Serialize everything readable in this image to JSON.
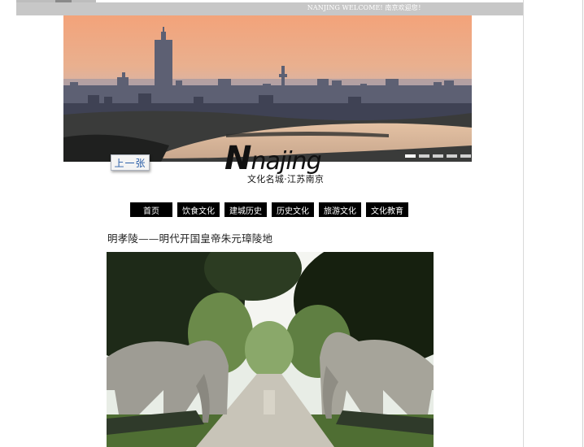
{
  "header": {
    "welcome_text": "NANJING WELCOME! 南京欢迎您！"
  },
  "banner": {
    "alt": "南京城市天际线",
    "slide_count": 5,
    "active_slide": 1
  },
  "prev_button": {
    "label": "上一张"
  },
  "logo": {
    "cap": "N",
    "word": "najing",
    "subtitle": "文化名城·江苏南京"
  },
  "nav": {
    "items": [
      {
        "label": "首页"
      },
      {
        "label": "饮食文化"
      },
      {
        "label": "建城历史"
      },
      {
        "label": "历史文化"
      },
      {
        "label": "旅游文化"
      },
      {
        "label": "文化教育"
      }
    ]
  },
  "article": {
    "title": "明孝陵——明代开国皇帝朱元璋陵地"
  },
  "colors": {
    "nav_bg": "#000000",
    "nav_text": "#ffffff",
    "welcome_bar": "#c7c7c7",
    "prev_text": "#2a5ea8"
  }
}
